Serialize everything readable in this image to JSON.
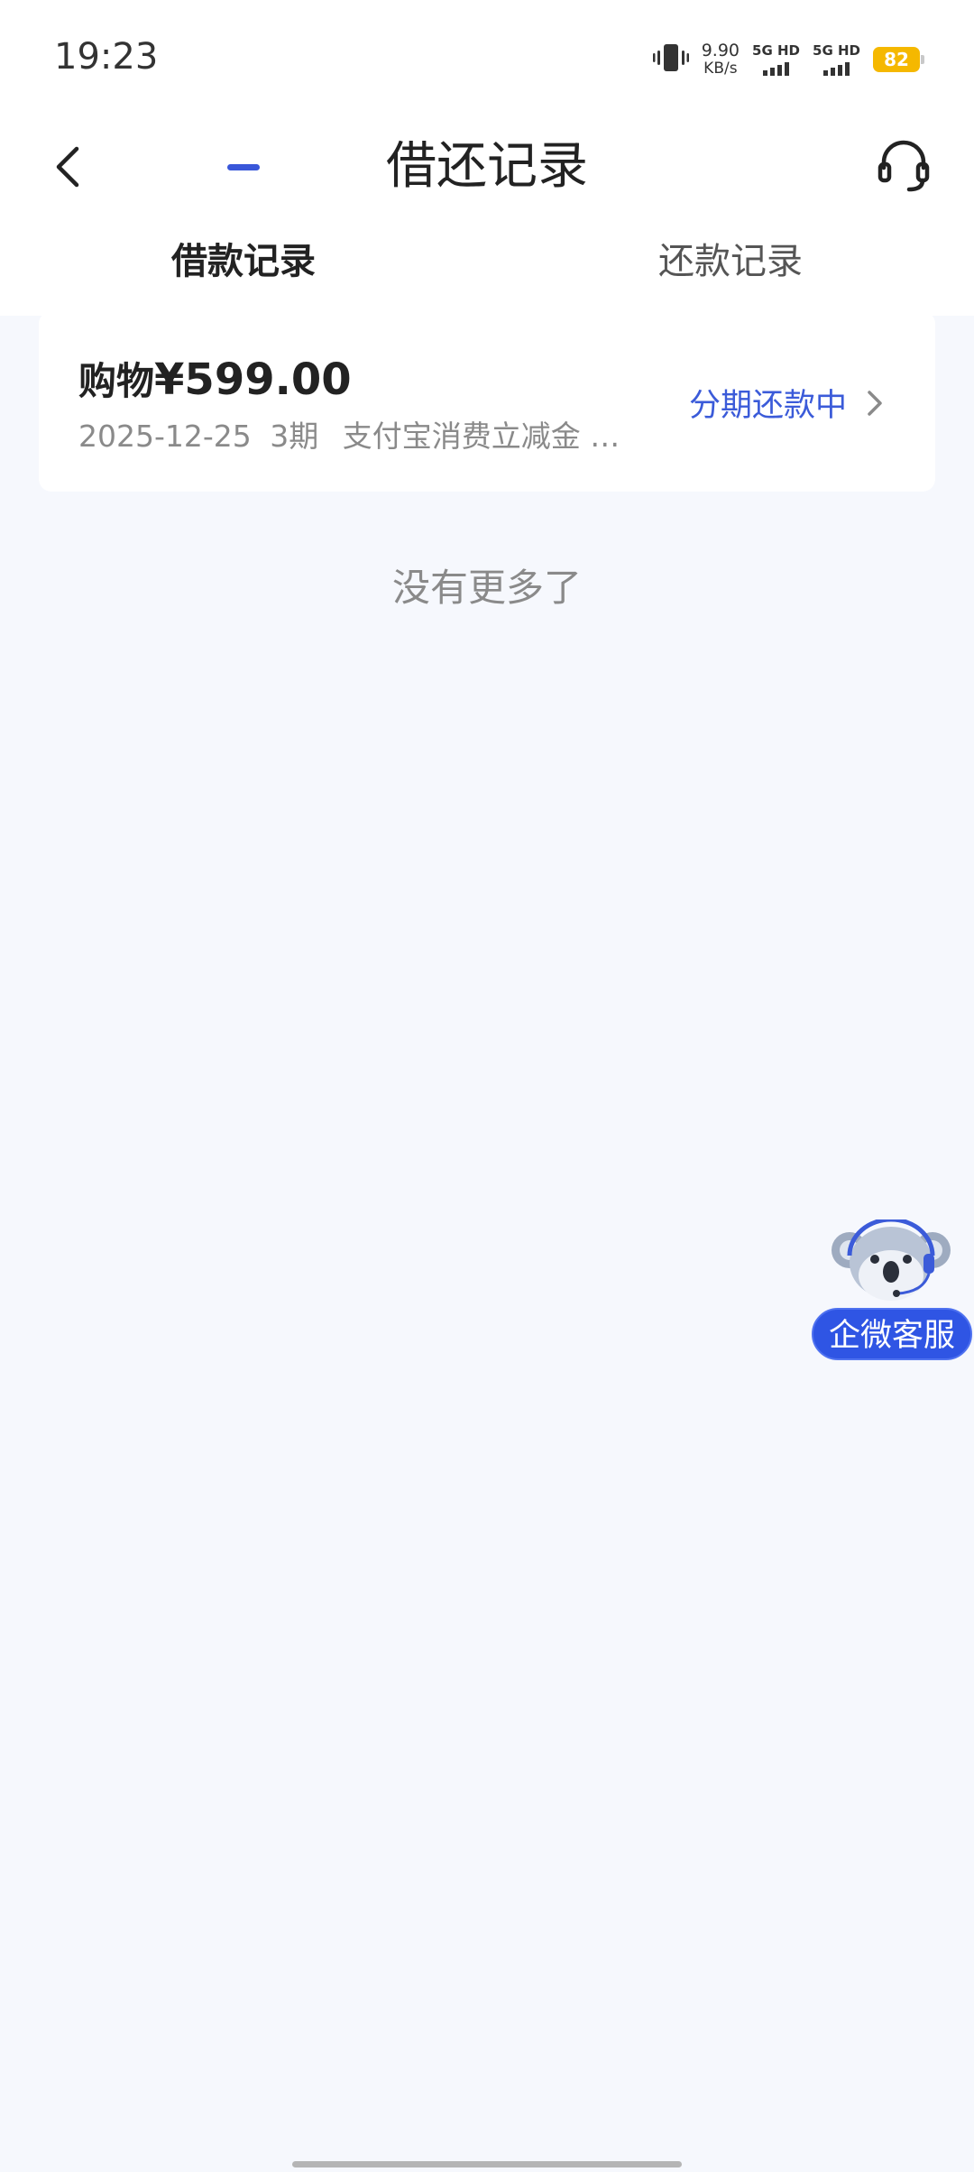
{
  "status_bar": {
    "time": "19:23",
    "net_speed_value": "9.90",
    "net_speed_unit": "KB/s",
    "sim1_label": "5G HD",
    "sim2_label": "5G HD",
    "battery_level": "82",
    "battery_color": "#f5b800",
    "icons": [
      "vibrate-icon",
      "signal-icon",
      "signal-icon"
    ]
  },
  "header": {
    "title": "借还记录",
    "back_icon": "chevron-left-icon",
    "support_icon": "headset-icon"
  },
  "tabs": [
    {
      "label": "借款记录",
      "active": true
    },
    {
      "label": "还款记录",
      "active": false
    }
  ],
  "records": [
    {
      "type_label": "购物",
      "amount": "¥599.00",
      "date": "2025-12-25",
      "installments": "3期",
      "note": "支付宝消费立减金 …",
      "status": "分期还款中",
      "status_icon": "chevron-right-icon"
    }
  ],
  "footer": {
    "no_more": "没有更多了"
  },
  "floating_support": {
    "label": "企微客服",
    "icon": "koala-mascot-icon"
  },
  "colors": {
    "accent": "#3957d9",
    "status_text": "#3b5bd9",
    "page_background": "#f6f8fd",
    "float_button": "#2f55e4"
  }
}
